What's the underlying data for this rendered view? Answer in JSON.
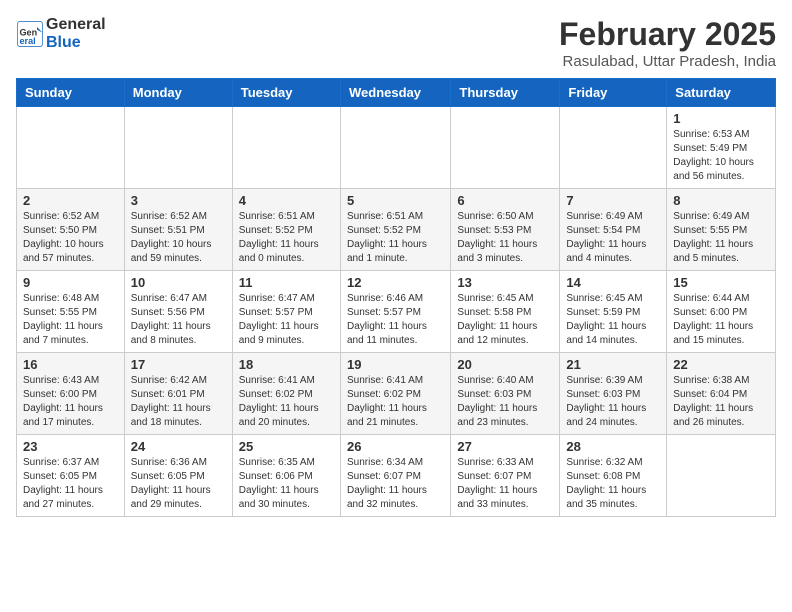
{
  "header": {
    "logo_general": "General",
    "logo_blue": "Blue",
    "month_title": "February 2025",
    "location": "Rasulabad, Uttar Pradesh, India"
  },
  "weekdays": [
    "Sunday",
    "Monday",
    "Tuesday",
    "Wednesday",
    "Thursday",
    "Friday",
    "Saturday"
  ],
  "weeks": [
    [
      {
        "day": "",
        "info": ""
      },
      {
        "day": "",
        "info": ""
      },
      {
        "day": "",
        "info": ""
      },
      {
        "day": "",
        "info": ""
      },
      {
        "day": "",
        "info": ""
      },
      {
        "day": "",
        "info": ""
      },
      {
        "day": "1",
        "info": "Sunrise: 6:53 AM\nSunset: 5:49 PM\nDaylight: 10 hours and 56 minutes."
      }
    ],
    [
      {
        "day": "2",
        "info": "Sunrise: 6:52 AM\nSunset: 5:50 PM\nDaylight: 10 hours and 57 minutes."
      },
      {
        "day": "3",
        "info": "Sunrise: 6:52 AM\nSunset: 5:51 PM\nDaylight: 10 hours and 59 minutes."
      },
      {
        "day": "4",
        "info": "Sunrise: 6:51 AM\nSunset: 5:52 PM\nDaylight: 11 hours and 0 minutes."
      },
      {
        "day": "5",
        "info": "Sunrise: 6:51 AM\nSunset: 5:52 PM\nDaylight: 11 hours and 1 minute."
      },
      {
        "day": "6",
        "info": "Sunrise: 6:50 AM\nSunset: 5:53 PM\nDaylight: 11 hours and 3 minutes."
      },
      {
        "day": "7",
        "info": "Sunrise: 6:49 AM\nSunset: 5:54 PM\nDaylight: 11 hours and 4 minutes."
      },
      {
        "day": "8",
        "info": "Sunrise: 6:49 AM\nSunset: 5:55 PM\nDaylight: 11 hours and 5 minutes."
      }
    ],
    [
      {
        "day": "9",
        "info": "Sunrise: 6:48 AM\nSunset: 5:55 PM\nDaylight: 11 hours and 7 minutes."
      },
      {
        "day": "10",
        "info": "Sunrise: 6:47 AM\nSunset: 5:56 PM\nDaylight: 11 hours and 8 minutes."
      },
      {
        "day": "11",
        "info": "Sunrise: 6:47 AM\nSunset: 5:57 PM\nDaylight: 11 hours and 9 minutes."
      },
      {
        "day": "12",
        "info": "Sunrise: 6:46 AM\nSunset: 5:57 PM\nDaylight: 11 hours and 11 minutes."
      },
      {
        "day": "13",
        "info": "Sunrise: 6:45 AM\nSunset: 5:58 PM\nDaylight: 11 hours and 12 minutes."
      },
      {
        "day": "14",
        "info": "Sunrise: 6:45 AM\nSunset: 5:59 PM\nDaylight: 11 hours and 14 minutes."
      },
      {
        "day": "15",
        "info": "Sunrise: 6:44 AM\nSunset: 6:00 PM\nDaylight: 11 hours and 15 minutes."
      }
    ],
    [
      {
        "day": "16",
        "info": "Sunrise: 6:43 AM\nSunset: 6:00 PM\nDaylight: 11 hours and 17 minutes."
      },
      {
        "day": "17",
        "info": "Sunrise: 6:42 AM\nSunset: 6:01 PM\nDaylight: 11 hours and 18 minutes."
      },
      {
        "day": "18",
        "info": "Sunrise: 6:41 AM\nSunset: 6:02 PM\nDaylight: 11 hours and 20 minutes."
      },
      {
        "day": "19",
        "info": "Sunrise: 6:41 AM\nSunset: 6:02 PM\nDaylight: 11 hours and 21 minutes."
      },
      {
        "day": "20",
        "info": "Sunrise: 6:40 AM\nSunset: 6:03 PM\nDaylight: 11 hours and 23 minutes."
      },
      {
        "day": "21",
        "info": "Sunrise: 6:39 AM\nSunset: 6:03 PM\nDaylight: 11 hours and 24 minutes."
      },
      {
        "day": "22",
        "info": "Sunrise: 6:38 AM\nSunset: 6:04 PM\nDaylight: 11 hours and 26 minutes."
      }
    ],
    [
      {
        "day": "23",
        "info": "Sunrise: 6:37 AM\nSunset: 6:05 PM\nDaylight: 11 hours and 27 minutes."
      },
      {
        "day": "24",
        "info": "Sunrise: 6:36 AM\nSunset: 6:05 PM\nDaylight: 11 hours and 29 minutes."
      },
      {
        "day": "25",
        "info": "Sunrise: 6:35 AM\nSunset: 6:06 PM\nDaylight: 11 hours and 30 minutes."
      },
      {
        "day": "26",
        "info": "Sunrise: 6:34 AM\nSunset: 6:07 PM\nDaylight: 11 hours and 32 minutes."
      },
      {
        "day": "27",
        "info": "Sunrise: 6:33 AM\nSunset: 6:07 PM\nDaylight: 11 hours and 33 minutes."
      },
      {
        "day": "28",
        "info": "Sunrise: 6:32 AM\nSunset: 6:08 PM\nDaylight: 11 hours and 35 minutes."
      },
      {
        "day": "",
        "info": ""
      }
    ]
  ]
}
